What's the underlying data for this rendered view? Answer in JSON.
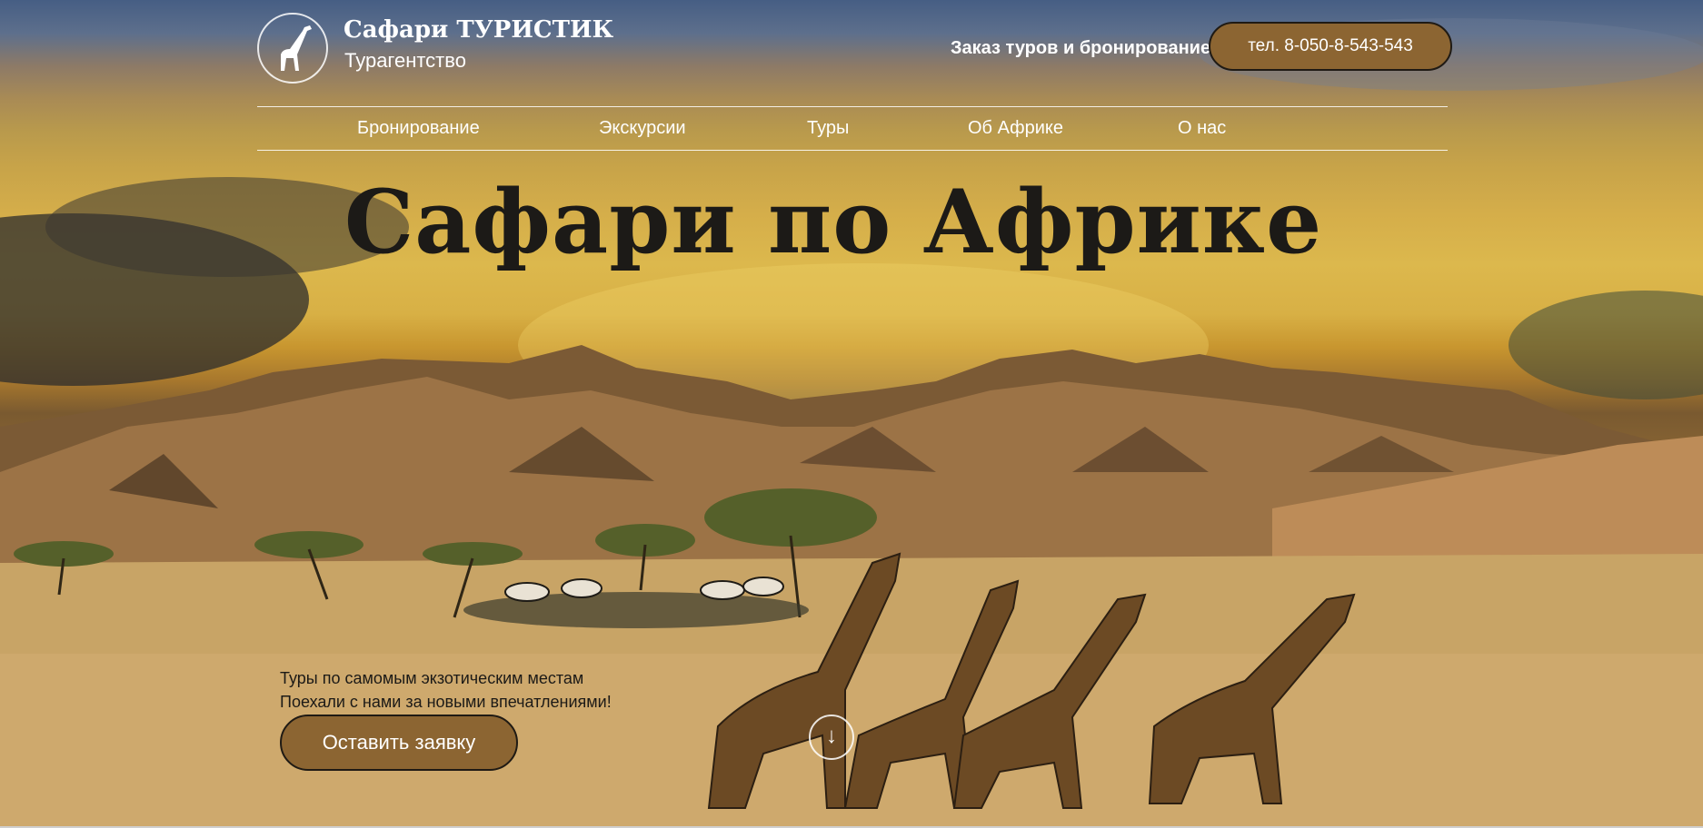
{
  "brand": {
    "name": "Сафари ТУРИСТИК",
    "subtitle": "Турагентство",
    "logo_icon": "giraffe-icon"
  },
  "header": {
    "order_label": "Заказ туров и бронирование:",
    "phone_button": "тел. 8-050-8-543-543"
  },
  "nav": {
    "items": [
      {
        "label": "Бронирование"
      },
      {
        "label": "Экскурсии"
      },
      {
        "label": "Туры"
      },
      {
        "label": "Об Африке"
      },
      {
        "label": "О нас"
      }
    ]
  },
  "hero": {
    "title": "Сафари по Африке",
    "tagline_1": "Туры по самомым экзотическим местам",
    "tagline_2": "Поехали с нами за новыми впечатлениями!",
    "cta_button": "Оставить заявку",
    "scroll_icon": "arrow-down-icon",
    "scroll_glyph": "↓"
  },
  "colors": {
    "accent": "#8c6532",
    "button_border": "#1f1a14",
    "title": "#1c1a17",
    "text_light": "#ffffff"
  }
}
